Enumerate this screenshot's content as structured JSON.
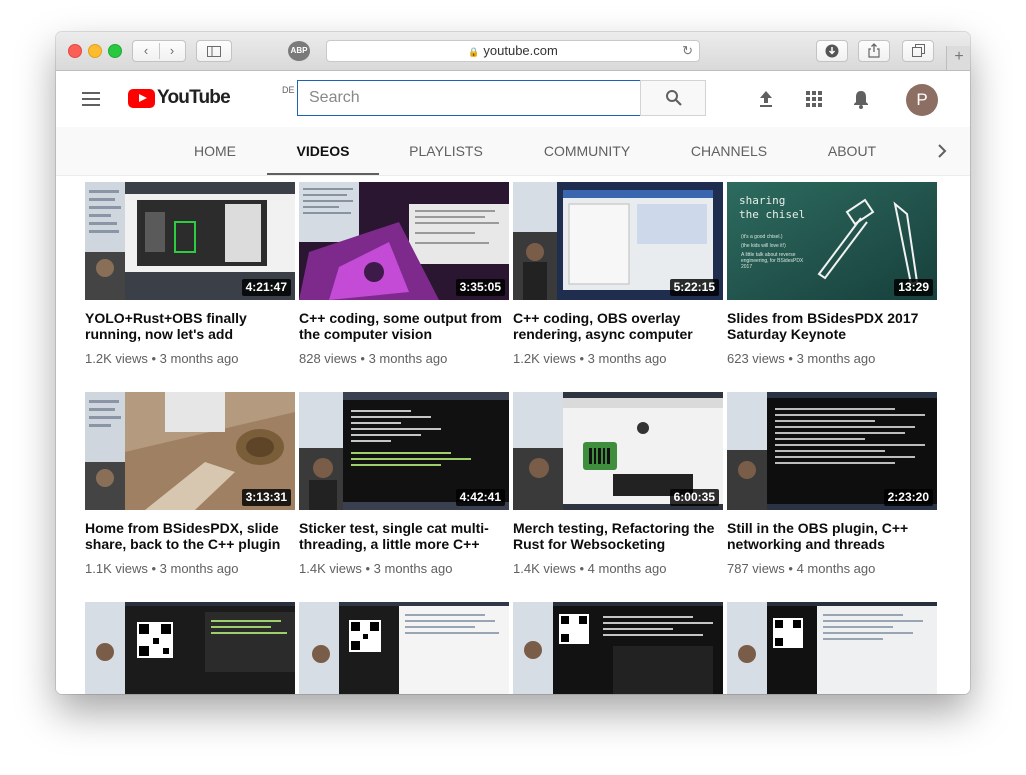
{
  "browser": {
    "url": "youtube.com",
    "adblock_badge": "ABP"
  },
  "masthead": {
    "logo_text": "YouTube",
    "country_code": "DE",
    "search_placeholder": "Search",
    "avatar_initial": "P"
  },
  "tabs": [
    "HOME",
    "VIDEOS",
    "PLAYLISTS",
    "COMMUNITY",
    "CHANNELS",
    "ABOUT"
  ],
  "active_tab": "VIDEOS",
  "videos": [
    {
      "title": "YOLO+Rust+OBS finally running, now let's add",
      "duration": "4:21:47",
      "views": "1.2K views",
      "age": "3 months ago"
    },
    {
      "title": "C++ coding, some output from the computer vision",
      "duration": "3:35:05",
      "views": "828 views",
      "age": "3 months ago"
    },
    {
      "title": "C++ coding, OBS overlay rendering, async computer",
      "duration": "5:22:15",
      "views": "1.2K views",
      "age": "3 months ago"
    },
    {
      "title": "Slides from BSidesPDX 2017 Saturday Keynote",
      "duration": "13:29",
      "views": "623 views",
      "age": "3 months ago"
    },
    {
      "title": "Home from BSidesPDX, slide share, back to the C++ plugin",
      "duration": "3:13:31",
      "views": "1.1K views",
      "age": "3 months ago"
    },
    {
      "title": "Sticker test, single cat multi-threading, a little more C++",
      "duration": "4:42:41",
      "views": "1.4K views",
      "age": "3 months ago"
    },
    {
      "title": "Merch testing, Refactoring the Rust for Websocketing",
      "duration": "6:00:35",
      "views": "1.4K views",
      "age": "4 months ago"
    },
    {
      "title": "Still in the OBS plugin, C++ networking and threads",
      "duration": "2:23:20",
      "views": "787 views",
      "age": "4 months ago"
    },
    {
      "title": "",
      "duration": "",
      "views": "",
      "age": ""
    },
    {
      "title": "",
      "duration": "",
      "views": "",
      "age": ""
    },
    {
      "title": "",
      "duration": "",
      "views": "",
      "age": ""
    },
    {
      "title": "",
      "duration": "",
      "views": "",
      "age": ""
    }
  ],
  "slide_text": {
    "heading_line1": "sharing",
    "heading_line2": "the chisel",
    "note1": "(it's a good chisel.)",
    "note2": "(the kids will love it!)",
    "note3": "A little talk about reverse engineering, for BSidesPDX 2017"
  },
  "colors": {
    "brand_red": "#ff0000",
    "search_focus": "#1c62b9",
    "avatar": "#8d6e63"
  }
}
